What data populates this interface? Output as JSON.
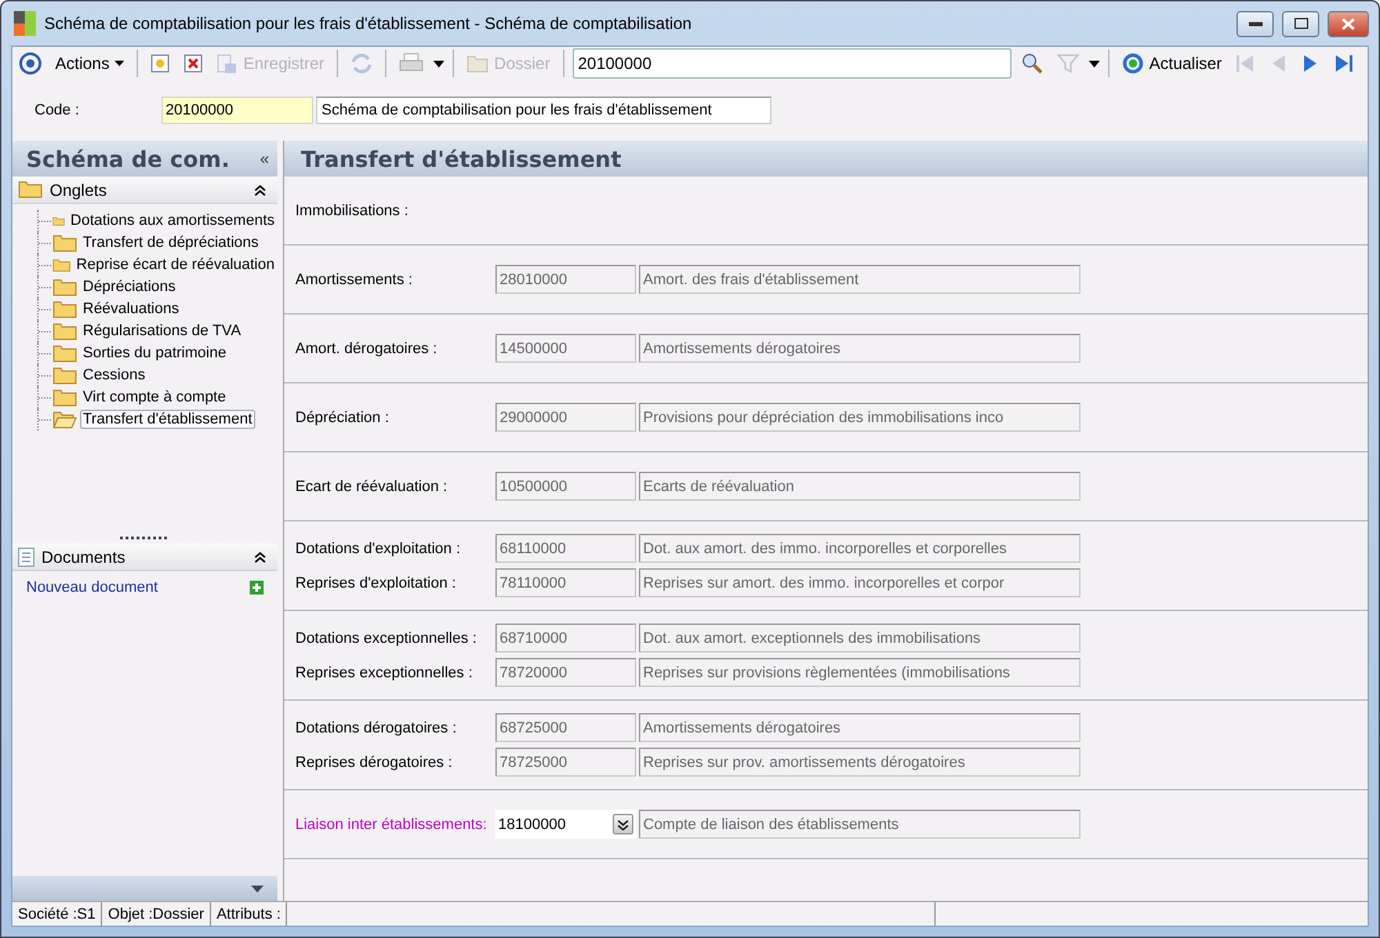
{
  "window": {
    "title": "Schéma de comptabilisation pour les frais d'établissement -  Schéma de comptabilisation"
  },
  "toolbar": {
    "items": [
      {
        "kind": "target"
      },
      {
        "kind": "menu",
        "label": "Actions"
      },
      {
        "kind": "sep"
      },
      {
        "kind": "new"
      },
      {
        "kind": "delete"
      },
      {
        "kind": "save",
        "label": "Enregistrer",
        "disabled": true
      },
      {
        "kind": "sep"
      },
      {
        "kind": "sync",
        "disabled": true
      },
      {
        "kind": "sep"
      },
      {
        "kind": "print",
        "disabled": true
      },
      {
        "kind": "caret"
      },
      {
        "kind": "sep"
      },
      {
        "kind": "folder",
        "label": "Dossier",
        "disabled": true
      },
      {
        "kind": "sep"
      },
      {
        "kind": "searchfield",
        "value": "20100000"
      },
      {
        "kind": "search"
      },
      {
        "kind": "filter",
        "disabled": true
      },
      {
        "kind": "caret"
      },
      {
        "kind": "sep"
      },
      {
        "kind": "refresh",
        "label": "Actualiser"
      },
      {
        "kind": "first",
        "disabled": true
      },
      {
        "kind": "prev",
        "disabled": true
      },
      {
        "kind": "next",
        "disabled": false
      },
      {
        "kind": "last",
        "disabled": false
      }
    ]
  },
  "code": {
    "label": "Code :",
    "value": "20100000",
    "description": "Schéma de comptabilisation pour les frais d'établissement"
  },
  "sidebar": {
    "title": "Schéma de com.",
    "collapse": "«",
    "tabs": {
      "title": "Onglets",
      "items": [
        {
          "label": "Dotations aux amortissements",
          "selected": false
        },
        {
          "label": "Transfert de dépréciations",
          "selected": false
        },
        {
          "label": "Reprise écart de réévaluation",
          "selected": false
        },
        {
          "label": "Dépréciations",
          "selected": false
        },
        {
          "label": "Réévaluations",
          "selected": false
        },
        {
          "label": "Régularisations de TVA",
          "selected": false
        },
        {
          "label": "Sorties du patrimoine",
          "selected": false
        },
        {
          "label": "Cessions",
          "selected": false
        },
        {
          "label": "Virt compte à compte",
          "selected": false
        },
        {
          "label": "Transfert d'établissement",
          "selected": true
        }
      ]
    },
    "documents": {
      "title": "Documents",
      "link": "Nouveau document"
    }
  },
  "main": {
    "title": "Transfert d'établissement",
    "groups": [
      {
        "rows": [
          {
            "label": "Immobilisations :"
          }
        ]
      },
      {
        "rows": [
          {
            "label": "Amortissements :",
            "code": "28010000",
            "description": "Amort. des frais d'établissement",
            "editable": false
          }
        ]
      },
      {
        "rows": [
          {
            "label": "Amort. dérogatoires :",
            "code": "14500000",
            "description": "Amortissements dérogatoires",
            "editable": false
          }
        ]
      },
      {
        "rows": [
          {
            "label": "Dépréciation :",
            "code": "29000000",
            "description": "Provisions pour dépréciation des immobilisations inco",
            "editable": false
          }
        ]
      },
      {
        "rows": [
          {
            "label": "Ecart de réévaluation :",
            "code": "10500000",
            "description": "Ecarts de réévaluation",
            "editable": false
          }
        ]
      },
      {
        "rows": [
          {
            "label": "Dotations d'exploitation :",
            "code": "68110000",
            "description": "Dot. aux amort. des immo. incorporelles et corporelles",
            "editable": false
          },
          {
            "label": "Reprises d'exploitation :",
            "code": "78110000",
            "description": "Reprises sur amort. des immo. incorporelles et corpor",
            "editable": false
          }
        ]
      },
      {
        "rows": [
          {
            "label": "Dotations exceptionnelles :",
            "code": "68710000",
            "description": "Dot. aux amort. exceptionnels des immobilisations",
            "editable": false
          },
          {
            "label": "Reprises exceptionnelles :",
            "code": "78720000",
            "description": "Reprises sur provisions règlementées (immobilisations",
            "editable": false
          }
        ]
      },
      {
        "rows": [
          {
            "label": "Dotations dérogatoires :",
            "code": "68725000",
            "description": "Amortissements dérogatoires",
            "editable": false
          },
          {
            "label": "Reprises dérogatoires :",
            "code": "78725000",
            "description": "Reprises sur prov. amortissements dérogatoires",
            "editable": false
          }
        ]
      },
      {
        "rows": [
          {
            "label": "Liaison inter établissements:",
            "code": "18100000",
            "description": "Compte de liaison des établissements",
            "editable": true
          }
        ]
      }
    ]
  },
  "status_bar": [
    "Société :S1",
    "Objet :Dossier",
    "Attributs :"
  ]
}
